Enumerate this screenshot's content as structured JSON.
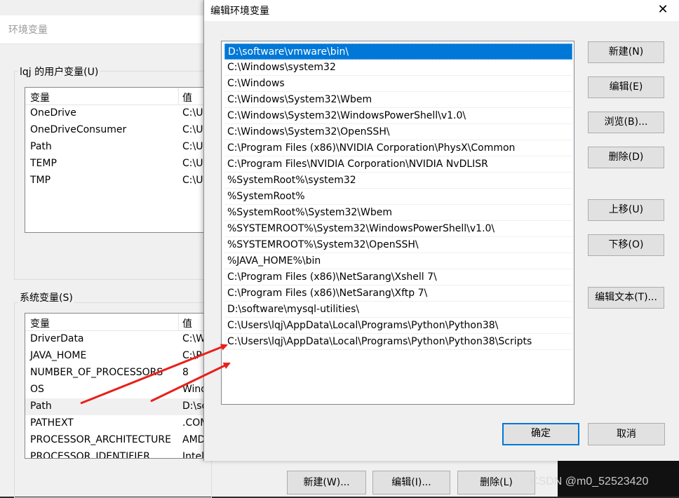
{
  "background_window": {
    "title": "环境变量",
    "user_vars": {
      "group_label": "lqj 的用户变量(U)",
      "headers": [
        "变量",
        "值"
      ],
      "rows": [
        [
          "OneDrive",
          "C:\\U"
        ],
        [
          "OneDriveConsumer",
          "C:\\U"
        ],
        [
          "Path",
          "C:\\U"
        ],
        [
          "TEMP",
          "C:\\U"
        ],
        [
          "TMP",
          "C:\\U"
        ]
      ]
    },
    "system_vars": {
      "group_label": "系统变量(S)",
      "headers": [
        "变量",
        "值"
      ],
      "rows": [
        [
          "DriverData",
          "C:\\W"
        ],
        [
          "JAVA_HOME",
          "C:\\P"
        ],
        [
          "NUMBER_OF_PROCESSORS",
          "8"
        ],
        [
          "OS",
          "Wind"
        ],
        [
          "Path",
          "D:\\so"
        ],
        [
          "PATHEXT",
          ".COM"
        ],
        [
          "PROCESSOR_ARCHITECTURE",
          "AMD"
        ],
        [
          "PROCESSOR_IDENTIFIER",
          "Intel"
        ]
      ]
    },
    "buttons": {
      "new": "新建(W)...",
      "edit": "编辑(I)...",
      "delete": "删除(L)"
    }
  },
  "dialog": {
    "title": "编辑环境变量",
    "close_glyph": "✕",
    "paths": [
      "D:\\software\\vmware\\bin\\",
      "C:\\Windows\\system32",
      "C:\\Windows",
      "C:\\Windows\\System32\\Wbem",
      "C:\\Windows\\System32\\WindowsPowerShell\\v1.0\\",
      "C:\\Windows\\System32\\OpenSSH\\",
      "C:\\Program Files (x86)\\NVIDIA Corporation\\PhysX\\Common",
      "C:\\Program Files\\NVIDIA Corporation\\NVIDIA NvDLISR",
      "%SystemRoot%\\system32",
      "%SystemRoot%",
      "%SystemRoot%\\System32\\Wbem",
      "%SYSTEMROOT%\\System32\\WindowsPowerShell\\v1.0\\",
      "%SYSTEMROOT%\\System32\\OpenSSH\\",
      "%JAVA_HOME%\\bin",
      "C:\\Program Files (x86)\\NetSarang\\Xshell 7\\",
      "C:\\Program Files (x86)\\NetSarang\\Xftp 7\\",
      "D:\\software\\mysql-utilities\\",
      "C:\\Users\\lqj\\AppData\\Local\\Programs\\Python\\Python38\\",
      "C:\\Users\\lqj\\AppData\\Local\\Programs\\Python\\Python38\\Scripts"
    ],
    "buttons": {
      "new": "新建(N)",
      "edit": "编辑(E)",
      "browse": "浏览(B)...",
      "delete": "删除(D)",
      "move_up": "上移(U)",
      "move_down": "下移(O)",
      "edit_text": "编辑文本(T)...",
      "ok": "确定",
      "cancel": "取消"
    }
  },
  "watermark": "CSDN @m0_52523420",
  "colors": {
    "selection": "#0078d7",
    "arrow": "#e8201c"
  }
}
